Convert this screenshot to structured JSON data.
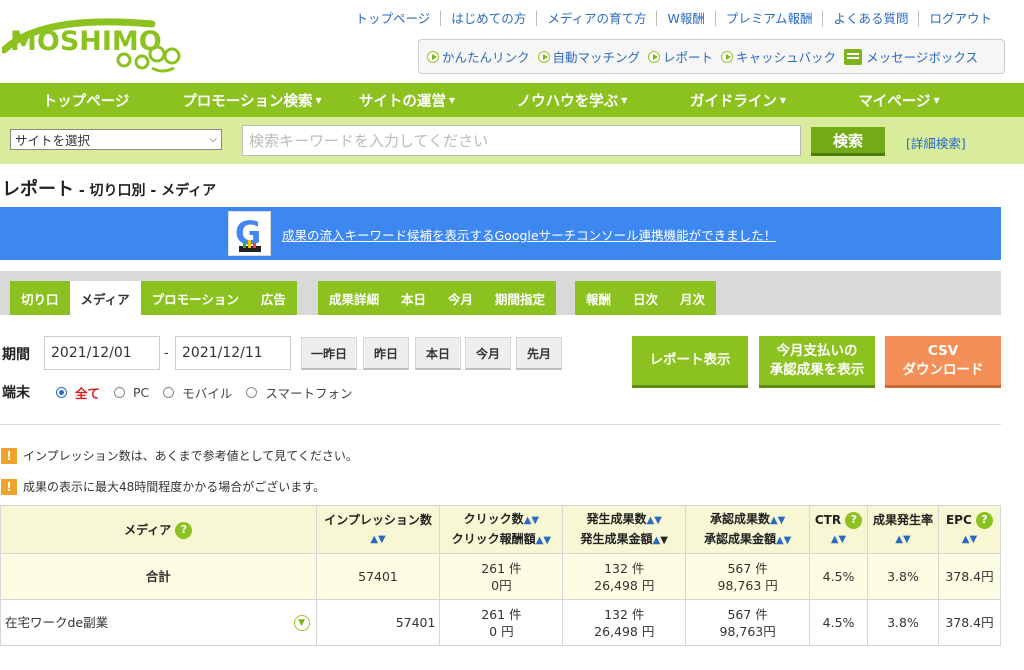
{
  "logo": {
    "text": "MOSHIMO"
  },
  "top_nav": [
    "トップページ",
    "はじめての方",
    "メディアの育て方",
    "W報酬",
    "プレミアム報酬",
    "よくある質問",
    "ログアウト"
  ],
  "quick_links": [
    "かんたんリンク",
    "自動マッチング",
    "レポート",
    "キャッシュバック",
    "メッセージボックス"
  ],
  "main_nav": [
    {
      "label": "トップページ",
      "caret": ""
    },
    {
      "label": "プロモーション検索",
      "caret": "▼"
    },
    {
      "label": "サイトの運営",
      "caret": "▼"
    },
    {
      "label": "ノウハウを学ぶ",
      "caret": "▼"
    },
    {
      "label": "ガイドライン",
      "caret": "▼"
    },
    {
      "label": "マイページ",
      "caret": "▼"
    }
  ],
  "search": {
    "site_select": "サイトを選択",
    "placeholder": "検索キーワードを入力してください",
    "button": "検索",
    "advanced": "[詳細検索]"
  },
  "page": {
    "title": "レポート",
    "subtitle": " - 切り口別 - メディア"
  },
  "banner": {
    "text": "成果の流入キーワード候補を表示するGoogleサーチコンソール連携機能ができました！"
  },
  "tabs": {
    "group1": [
      "切り口",
      "メディア",
      "プロモーション",
      "広告"
    ],
    "group2": [
      "成果詳細",
      "本日",
      "今月",
      "期間指定"
    ],
    "group3": [
      "報酬",
      "日次",
      "月次"
    ]
  },
  "period": {
    "label": "期間",
    "start": "2021/12/01",
    "sep": "-",
    "end": "2021/12/11",
    "quick": [
      "一昨日",
      "昨日",
      "本日",
      "今月",
      "先月"
    ]
  },
  "actions": {
    "report": "レポート表示",
    "approved_1": "今月支払いの",
    "approved_2": "承認成果を表示",
    "csv_1": "CSV",
    "csv_2": "ダウンロード"
  },
  "device": {
    "label": "端末",
    "options": [
      "全て",
      "PC",
      "モバイル",
      "スマートフォン"
    ]
  },
  "notices": [
    "インプレッション数は、あくまで参考値として見てください。",
    "成果の表示に最大48時間程度かかる場合がございます。"
  ],
  "table": {
    "headers": {
      "media": "メディア",
      "imp": "インプレッション数",
      "click": "クリック数",
      "click_reward": "クリック報酬額",
      "occ": "発生成果数",
      "occ_amount": "発生成果金額",
      "appr": "承認成果数",
      "appr_amount": "承認成果金額",
      "ctr": "CTR",
      "rate": "成果発生率",
      "epc": "EPC"
    },
    "total": {
      "label": "合計",
      "imp": "57401",
      "click": "261 件",
      "click_reward": "0円",
      "occ": "132 件",
      "occ_amount": "26,498 円",
      "appr": "567 件",
      "appr_amount": "98,763 円",
      "ctr": "4.5%",
      "rate": "3.8%",
      "epc": "378.4円"
    },
    "rows": [
      {
        "media": "在宅ワークde副業",
        "imp": "57401",
        "click": "261 件",
        "click_reward": "0 円",
        "occ": "132 件",
        "occ_amount": "26,498 円",
        "appr": "567 件",
        "appr_amount": "98,763円",
        "ctr": "4.5%",
        "rate": "3.8%",
        "epc": "378.4円"
      }
    ]
  },
  "colors": {
    "brand_green": "#8cc21f",
    "banner_blue": "#3d87f0",
    "csv_orange": "#f48f57",
    "link_blue": "#2a6bc2"
  }
}
